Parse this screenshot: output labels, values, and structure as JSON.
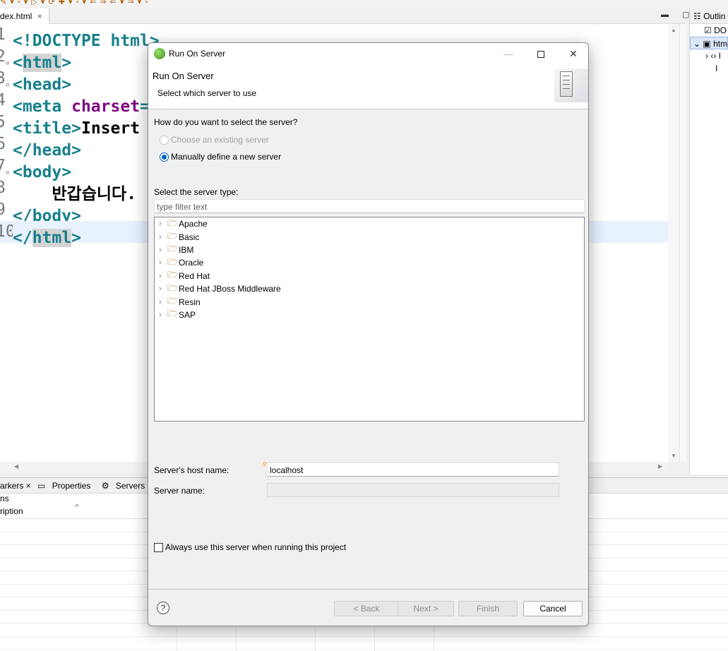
{
  "toolbar": {
    "icons": "✎ ▾ ▫ ▾ ▷ ▾ ⟳ ✚ ▾ ▫ ▾ ⇐ ⇒ ⇐ ▾ ⇒ ▾ ▫"
  },
  "editor": {
    "tab_label": "dex.html",
    "tab_close": "×",
    "lines": [
      {
        "num": "1",
        "fold": "",
        "parts": [
          [
            "brk",
            "<!"
          ],
          [
            "tag",
            "DOCTYPE html"
          ],
          [
            "brk",
            ">"
          ]
        ]
      },
      {
        "num": "2",
        "fold": "⊖",
        "parts": [
          [
            "brk",
            "<"
          ],
          [
            "tag-hl",
            "html"
          ],
          [
            "brk",
            ">"
          ]
        ]
      },
      {
        "num": "3",
        "fold": "⊖",
        "parts": [
          [
            "brk",
            "<"
          ],
          [
            "tag",
            "head"
          ],
          [
            "brk",
            ">"
          ]
        ]
      },
      {
        "num": "4",
        "fold": "",
        "parts": [
          [
            "brk",
            "<"
          ],
          [
            "tag",
            "meta "
          ],
          [
            "attr",
            "charset"
          ],
          [
            "brk",
            "="
          ]
        ]
      },
      {
        "num": "5",
        "fold": "",
        "parts": [
          [
            "brk",
            "<"
          ],
          [
            "tag",
            "title"
          ],
          [
            "brk",
            ">"
          ],
          [
            "text",
            "Insert"
          ]
        ]
      },
      {
        "num": "6",
        "fold": "",
        "parts": [
          [
            "brk",
            "</"
          ],
          [
            "tag",
            "head"
          ],
          [
            "brk",
            ">"
          ]
        ]
      },
      {
        "num": "7",
        "fold": "⊖",
        "parts": [
          [
            "brk",
            "<"
          ],
          [
            "tag",
            "body"
          ],
          [
            "brk",
            ">"
          ]
        ]
      },
      {
        "num": "8",
        "fold": "",
        "parts": [
          [
            "text",
            "    반갑습니다."
          ]
        ]
      },
      {
        "num": "9",
        "fold": "",
        "parts": [
          [
            "brk",
            "</"
          ],
          [
            "tag",
            "body"
          ],
          [
            "brk",
            ">"
          ]
        ]
      },
      {
        "num": "10",
        "fold": "",
        "parts": [
          [
            "brk",
            "</"
          ],
          [
            "tag-hl",
            "html"
          ],
          [
            "brk",
            ">"
          ]
        ]
      }
    ],
    "window_controls": "▬ ▢"
  },
  "outline": {
    "title": "Outlin",
    "rows": [
      "DO",
      "htm",
      "› ‹› I",
      "I"
    ]
  },
  "bottom": {
    "tabs": [
      "arkers ×",
      "Properties",
      "Servers"
    ],
    "items_label": "ns",
    "column_header": "ription"
  },
  "dialog": {
    "title": "Run On Server",
    "banner_title": "Run On Server",
    "banner_desc": "Select which server to use",
    "question": "How do you want to select the server?",
    "option_existing": "Choose an existing server",
    "option_manual": "Manually define a new server",
    "type_label": "Select the server type:",
    "filter_placeholder": "type filter text",
    "server_types": [
      "Apache",
      "Basic",
      "IBM",
      "Oracle",
      "Red Hat",
      "Red Hat JBoss Middleware",
      "Resin",
      "SAP"
    ],
    "host_label": "Server's host name:",
    "host_value": "localhost",
    "name_label": "Server name:",
    "name_value": "",
    "always_use_label": "Always use this server when running this project",
    "buttons": {
      "help": "?",
      "back": "< Back",
      "next": "Next >",
      "finish": "Finish",
      "cancel": "Cancel"
    }
  }
}
